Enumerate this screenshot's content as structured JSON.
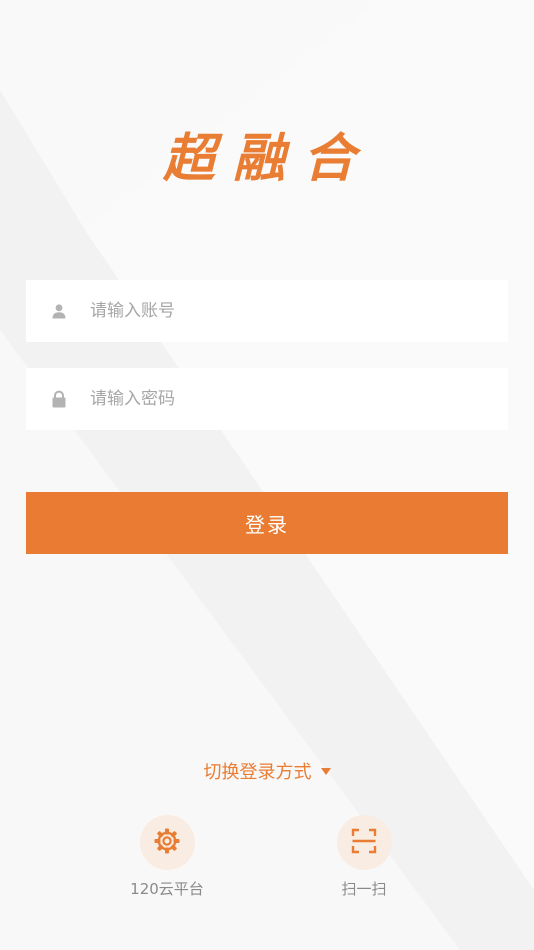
{
  "app": {
    "logo_text": "超融合"
  },
  "login": {
    "account_placeholder": "请输入账号",
    "password_placeholder": "请输入密码",
    "login_label": "登录"
  },
  "footer": {
    "switch_label": "切换登录方式",
    "shortcuts": [
      {
        "label": "120云平台",
        "icon": "gear-icon"
      },
      {
        "label": "扫一扫",
        "icon": "scan-icon"
      }
    ]
  },
  "colors": {
    "accent": "#e97c32",
    "background": "#f7f7f7",
    "field_background": "#ffffff",
    "placeholder": "#a6a6a6",
    "icon_gray": "#b3b3b3",
    "shortcut_bg": "#f8ece3"
  }
}
